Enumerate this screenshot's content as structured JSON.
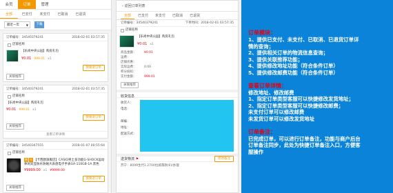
{
  "left": {
    "top_tabs": [
      "会员",
      "订单",
      "管理"
    ],
    "status_tabs": [
      "全部",
      "已支付",
      "未支付",
      "已取消",
      "已退货"
    ],
    "filter": {
      "period": "最近一年",
      "button": "下载"
    },
    "orders": [
      {
        "no": "订单编号：34540379241",
        "time": "2018-02-01 03:57:35",
        "shop": "店铺名称",
        "product": "【乐尚中央公园】购房礼包",
        "price": "¥0.01",
        "orig_price": "999.01",
        "qty": "x1",
        "action": "我要退订单",
        "btn": "关联推荐"
      },
      {
        "no": "订单编号：34540379241",
        "time": "2018-02-01 03:57:35",
        "shop": "店铺名称",
        "product": "【乐尚中央公园】购房礼包",
        "price": "¥0.01",
        "orig_price": "999.01",
        "qty": "x1",
        "action": "我要退订单",
        "btn": "关联推荐"
      },
      {
        "no": "订单编号：34540347555",
        "time": "2018-01-07 00:55:64",
        "shop": "店铺名称",
        "tags": [
          "热",
          "卡"
        ],
        "product": "【卡西欧旗舰店】CASIO男士多功能G-SHOCK运动休闲双显防水防磁大表盘电子手表GA-110GB-1A 黑色",
        "price": "¥9999.00",
        "orig_price": "¥9999.00",
        "qty": "x1",
        "action": "我要退订单",
        "btn": "关联推荐"
      }
    ],
    "more": "查看订单详情"
  },
  "mid": {
    "back": "返回订单列表",
    "tabs": [
      "全部",
      "已支付",
      "未支付",
      "已取消",
      "已退货"
    ],
    "order_no": "订单编号：34540379241",
    "order_time": "下单时间：2018-02-01 03:57:35",
    "shop": "店铺名称",
    "product": "【乐尚中央公园】购房礼包",
    "price": "¥0.01",
    "qty": "x1",
    "details": [
      {
        "k": "商品金额：",
        "v": "¥0.01"
      },
      {
        "k": "运费：",
        "v": ""
      },
      {
        "k": "店铺优惠：",
        "v": ""
      },
      {
        "k": "实际运费：",
        "v": "0.00"
      },
      {
        "k": "积分抵扣：",
        "v": ""
      },
      {
        "k": "实付金额：",
        "v": "999.01"
      }
    ],
    "detail_btn": "关联推荐",
    "recv_title": "收货信息",
    "recv_labels": [
      "收货人：",
      "电话：",
      "",
      "邮编：",
      "地址：",
      "配送方式："
    ],
    "ship_title": "送货物流",
    "ship_btn": "修改备注",
    "ship_info": "苏宁：8099生代1.2700拉城落款(6)/办理"
  },
  "right": {
    "sections": [
      {
        "heading": "订单模块：",
        "lines": [
          "1、提供已支付、未支付、已取消、已退货订单详",
          "情的查询；",
          "2、提供相关订单的物流信息查询；",
          "3、提供关联推荐功能；",
          "4、提供修改地址功能（符合条件订单）",
          "5、提供修改邮费功能（符合条件订单）"
        ]
      },
      {
        "heading": "查看订单详情：",
        "lines": [
          "修改地址、修改邮费",
          "1、指定订单类型客服可以快捷修改发货地址；",
          "2、指定订单类型客服可以快捷修改邮费；",
          "未支付订单可以修改邮费",
          "未发货订单可以修改发货地址"
        ]
      },
      {
        "heading": "订单备注：",
        "lines": [
          "已完成订单，可以进行订单备注，功能与商户后台",
          "订单备注同步，此处为快捷订单备注入口，方便客",
          "服操作"
        ]
      }
    ]
  }
}
